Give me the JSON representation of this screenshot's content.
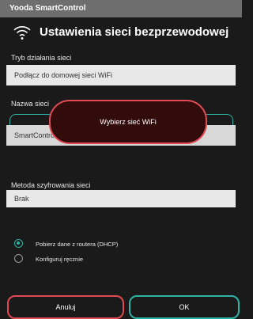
{
  "appbar": {
    "title": "Yooda SmartControl"
  },
  "header": {
    "title": "Ustawienia sieci bezprzewodowej",
    "icon": "wifi-icon"
  },
  "mode": {
    "label": "Tryb działania sieci",
    "value": "Podłącz do domowej sieci WiFi"
  },
  "network_name": {
    "label": "Nazwa sieci",
    "value": "SmartControl"
  },
  "toast": {
    "text": "Wybierz sieć WiFi"
  },
  "encryption": {
    "label": "Metoda szyfrowania sieci",
    "value": "Brak"
  },
  "ip_options": [
    {
      "label": "Pobierz dane z routera (DHCP)",
      "selected": true
    },
    {
      "label": "Konfiguruj ręcznie",
      "selected": false
    }
  ],
  "buttons": {
    "cancel": "Anuluj",
    "ok": "OK"
  },
  "colors": {
    "accent_teal": "#2fb3a6",
    "accent_red": "#e14a55",
    "background": "#1a1a1a"
  }
}
